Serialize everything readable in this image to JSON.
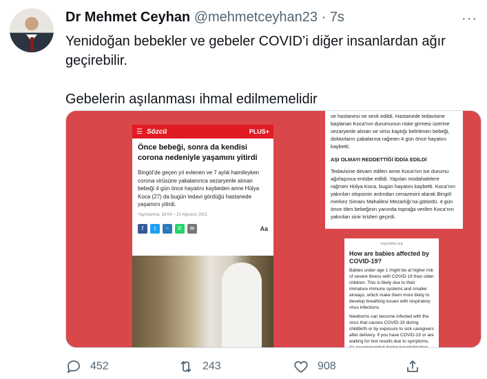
{
  "tweet": {
    "author_name": "Dr Mehmet Ceyhan",
    "handle": "@mehmetceyhan23",
    "separator": "·",
    "time": "7s",
    "more": "···",
    "text_line1": "Yenidoğan bebekler ve gebeler COVID’i diğer insanlardan ağır geçirebilir.",
    "text_line2": "Gebelerin aşılanması ihmal edilmemelidir"
  },
  "media": {
    "article": {
      "brand": "Sözcü",
      "plus": "PLUS+",
      "title": "Önce bebeği, sonra da kendisi corona nedeniyle yaşamını yitirdi",
      "body": "Bingöl’de geçen yıl evlenen ve 7 aylık hamileyken corona virüsüne yakalanınca sezaryenle alınan bebeği 4 gün önce hayatını kaybeden anne Hülya Koca (27) da bugün tedavi gördüğü hastanede yaşamını yitirdi.",
      "meta": "Yayınlanma: 16:04 – 21 Ağustos 2021",
      "aa": "Aa"
    },
    "article2": {
      "p1": "ve hastanesi ne sevk edildi. Hastanede tedavisine başlanan Koca’nın durumunun riske girmesi üzerine sezaryenle alınan ve virüs kaptığı belirlenen bebeği, doktorların çabalarına rağmen 4 gün önce hayatını kaybetti.",
      "heading": "AŞI OLMAYI REDDETTİĞİ İDDİA EDİLDİ",
      "p2": "Tedavisine devam edilen anne Koca’nın ise durumu ağırlaşınca entübe edildi. Yapılan müdahalelere rağmen Hülya Koca, bugün hayatını kaybetti. Koca’nın yakınları otopsinin ardından cenazesini alarak Bingöl merkez Simanı Mahallesi Mezarlığı’na götürdü. 4 gün önce ölen bebeğinin yanında toprağa verilen Koca’nın yakınları sinir krizleri geçirdi."
    },
    "article3": {
      "url": "mayoclinic.org",
      "heading": "How are babies affected by COVID-19?",
      "p1": "Babies under age 1 might be at higher risk of severe illness with COVID-19 than older children. This is likely due to their immature immune systems and smaller airways, which make them more likely to develop breathing issues with respiratory virus infections.",
      "p2": "Newborns can become infected with the virus that causes COVID-19 during childbirth or by exposure to sick caregivers after delivery. If you have COVID-19 or are waiting for test results due to symptoms, it’s recommended during hospitalization after childbirth that you wear a cloth face mask and have clean hands when caring for your newborn. Keeping your newborn’s crib by your bed while you are in the hospital is"
    }
  },
  "actions": {
    "reply_count": "452",
    "retweet_count": "243",
    "like_count": "908"
  },
  "colors": {
    "media_bg": "#d9474a",
    "brand_red": "#e11b22",
    "muted": "#536471"
  }
}
